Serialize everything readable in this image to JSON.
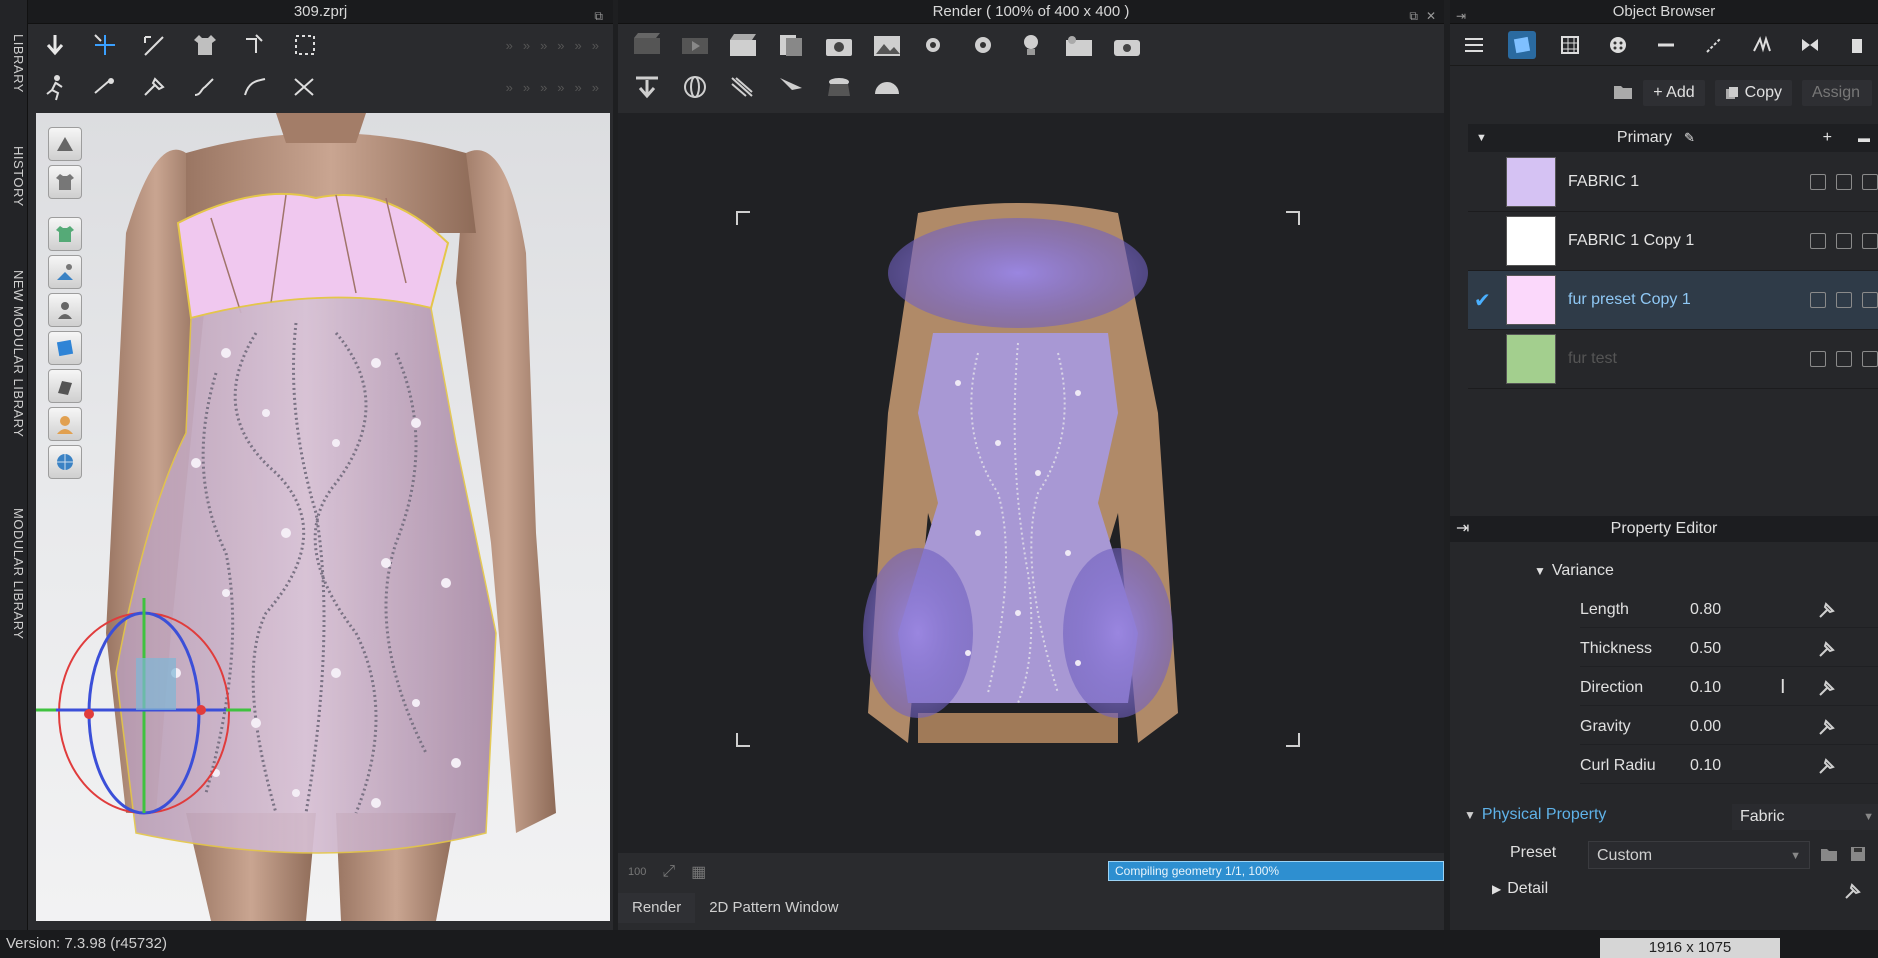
{
  "library_tabs": [
    "LIBRARY",
    "HISTORY",
    "NEW MODULAR LIBRARY",
    "MODULAR LIBRARY"
  ],
  "viewport3d": {
    "title": "309.zprj"
  },
  "render": {
    "title": "Render ( 100% of 400 x 400 )",
    "progress_text": "Compiling geometry 1/1, 100%",
    "zoom_label": "100",
    "tabs": [
      "Render",
      "2D Pattern Window"
    ]
  },
  "object_browser": {
    "title": "Object Browser",
    "add_label": "+ Add",
    "copy_label": "Copy",
    "assign_label": "Assign",
    "group_label": "Primary",
    "fabrics": [
      {
        "name": "FABRIC 1",
        "color": "#d5c2f3",
        "selected": false
      },
      {
        "name": "FABRIC 1 Copy 1",
        "color": "#ffffff",
        "selected": false
      },
      {
        "name": "fur preset Copy 1",
        "color": "#fbd8fb",
        "selected": true
      },
      {
        "name": "fur test",
        "color": "#a3cf8e",
        "selected": false
      }
    ]
  },
  "property_editor": {
    "title": "Property Editor",
    "variance_label": "Variance",
    "properties": [
      {
        "label": "Length",
        "value": "0.80"
      },
      {
        "label": "Thickness",
        "value": "0.50"
      },
      {
        "label": "Direction",
        "value": "0.10"
      },
      {
        "label": "Gravity",
        "value": "0.00"
      },
      {
        "label": "Curl Radiu",
        "value": "0.10"
      }
    ],
    "physical_label": "Physical Property",
    "physical_value": "Fabric",
    "preset_label": "Preset",
    "preset_value": "Custom",
    "detail_label": "Detail"
  },
  "status": {
    "version": "Version: 7.3.98 (r45732)",
    "resolution": "1916 x 1075"
  }
}
